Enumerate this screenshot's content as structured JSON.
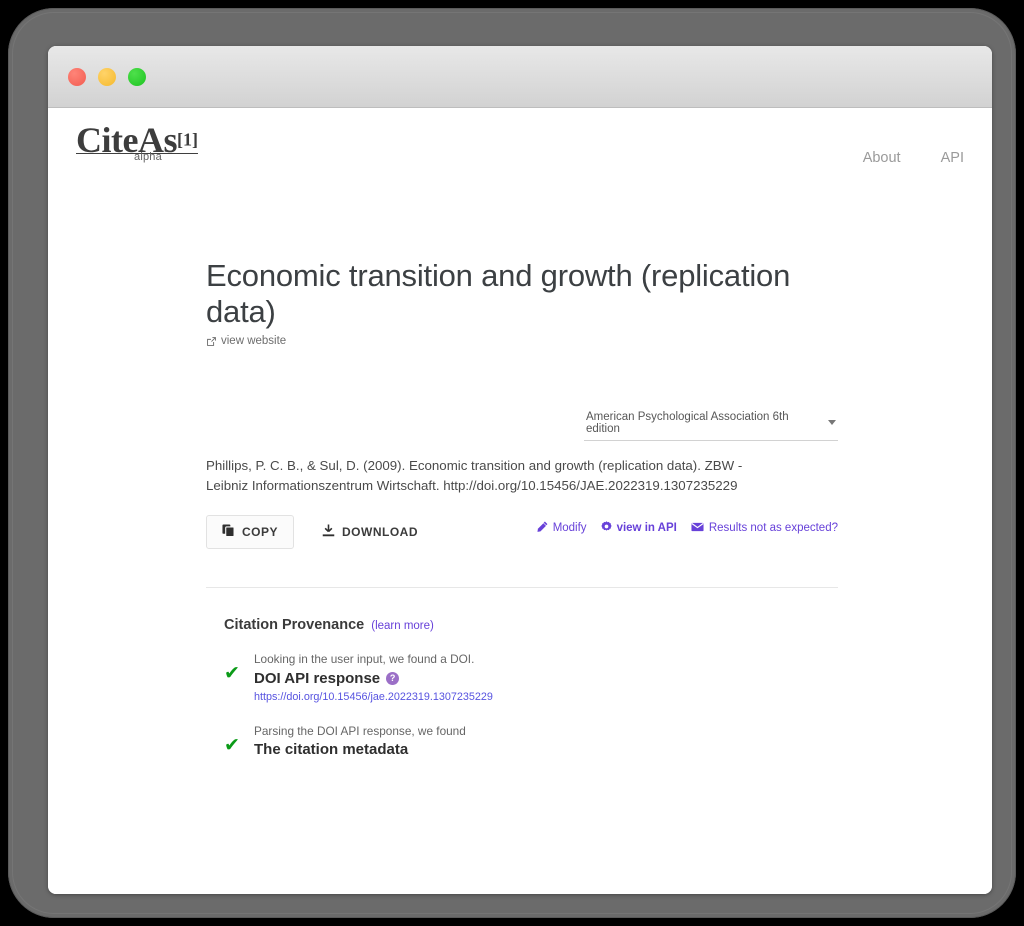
{
  "window": {
    "traffic_lights": [
      "close",
      "minimize",
      "zoom"
    ]
  },
  "header": {
    "logo_word": "CiteAs",
    "logo_superscript": "[1]",
    "logo_tag": "alpha",
    "nav": [
      {
        "label": "About"
      },
      {
        "label": "API"
      }
    ]
  },
  "main": {
    "title": "Economic transition and growth (replication data)",
    "view_website_label": "view website",
    "style_select": {
      "value": "American Psychological Association 6th edition"
    },
    "citation": "Phillips, P. C. B., & Sul, D. (2009). Economic transition and growth (replication data). ZBW - Leibniz Informationszentrum Wirtschaft. http://doi.org/10.15456/JAE.2022319.1307235229",
    "copy_label": "COPY",
    "download_label": "DOWNLOAD",
    "secondary_links": [
      {
        "label": "Modify",
        "icon": "pencil-icon"
      },
      {
        "label": "view in API",
        "icon": "gear-icon"
      },
      {
        "label": "Results not as expected?",
        "icon": "envelope-icon"
      }
    ]
  },
  "provenance": {
    "heading": "Citation Provenance",
    "learn_more": "(learn more)",
    "steps": [
      {
        "check": "✔",
        "lead": "Looking in the user input, we found a DOI.",
        "title": "DOI API response",
        "help": "?",
        "link": "https://doi.org/10.15456/jae.2022319.1307235229"
      },
      {
        "check": "✔",
        "lead": "Parsing the DOI API response, we found",
        "title": "The citation metadata"
      }
    ]
  },
  "colors": {
    "accent_purple": "#6741d9",
    "link_blue": "#5753e0",
    "check_green": "#0b9b18",
    "bezel_gray": "#6b6b6b"
  }
}
